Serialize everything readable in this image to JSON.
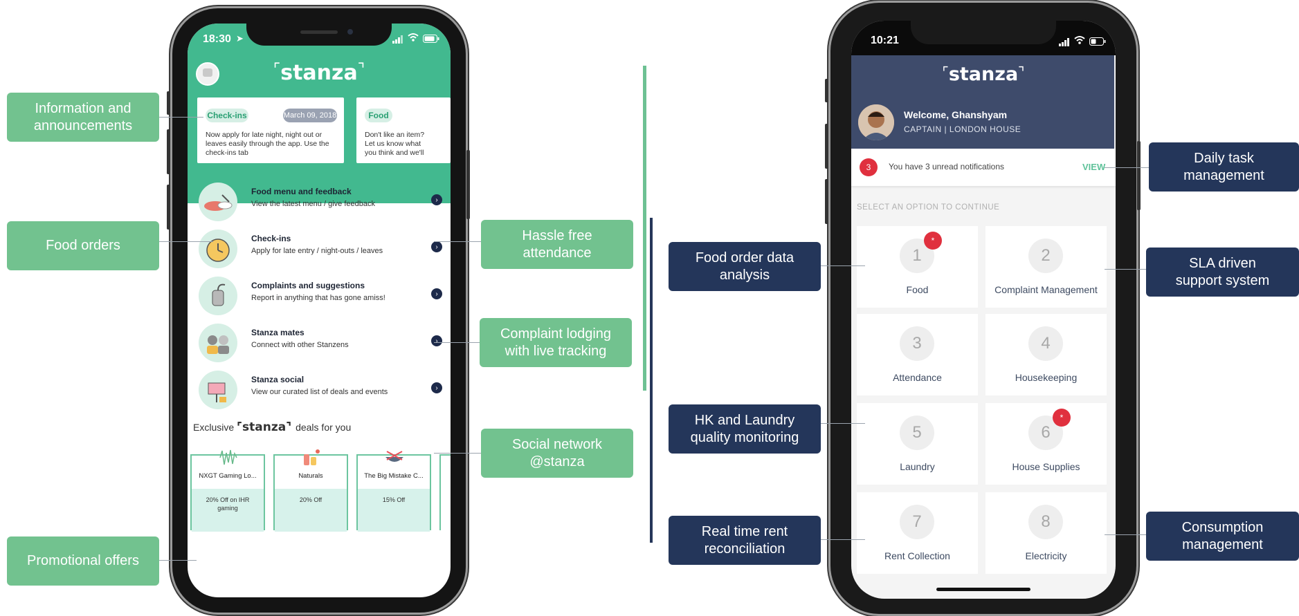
{
  "left_phone": {
    "status_time": "18:30",
    "logo": "stanza",
    "cards": [
      {
        "tag": "Check-ins",
        "date": "March 09, 2018",
        "text": "Now apply for late night, night out or leaves easily through the app. Use the check-ins tab"
      },
      {
        "tag": "Food",
        "text": "Don't like an item? Let us know what you think and we'll continuously improve"
      }
    ],
    "menu": [
      {
        "title": "Food menu and feedback",
        "subtitle": "View the latest menu / give feedback"
      },
      {
        "title": "Check-ins",
        "subtitle": "Apply for late entry / night-outs / leaves"
      },
      {
        "title": "Complaints and suggestions",
        "subtitle": "Report in anything that has gone amiss!"
      },
      {
        "title": "Stanza mates",
        "subtitle": "Connect with other Stanzens"
      },
      {
        "title": "Stanza social",
        "subtitle": "View our curated list of deals and events"
      }
    ],
    "deals_prefix": "Exclusive",
    "deals_logo": "stanza",
    "deals_suffix": "deals for you",
    "deals": [
      {
        "name": "NXGT Gaming Lo...",
        "offer": "20% Off on IHR gaming"
      },
      {
        "name": "Naturals",
        "offer": "20% Off"
      },
      {
        "name": "The Big Mistake C...",
        "offer": "15% Off"
      }
    ]
  },
  "right_phone": {
    "status_time": "10:21",
    "logo": "stanza",
    "welcome": "Welcome, Ghanshyam",
    "role": "CAPTAIN | LONDON HOUSE",
    "notif_count": "3",
    "notif_text": "You have 3 unread notifications",
    "view_label": "VIEW",
    "select_prompt": "SELECT AN OPTION TO CONTINUE",
    "tiles": [
      {
        "num": "1",
        "label": "Food",
        "badge": "*"
      },
      {
        "num": "2",
        "label": "Complaint Management"
      },
      {
        "num": "3",
        "label": "Attendance"
      },
      {
        "num": "4",
        "label": "Housekeeping"
      },
      {
        "num": "5",
        "label": "Laundry"
      },
      {
        "num": "6",
        "label": "House Supplies",
        "badge": "*"
      },
      {
        "num": "7",
        "label": "Rent Collection"
      },
      {
        "num": "8",
        "label": "Electricity"
      }
    ]
  },
  "callouts": {
    "info": "Information and\nannouncements",
    "food_orders": "Food orders",
    "promo": "Promotional offers",
    "attendance": "Hassle free\nattendance",
    "complaint": "Complaint lodging\nwith live tracking",
    "social": "Social network\n@stanza",
    "food_analysis": "Food order data\nanalysis",
    "hk": "HK and Laundry\nquality monitoring",
    "rent": "Real time rent\nreconciliation",
    "daily": "Daily task\nmanagement",
    "sla": "SLA driven\nsupport system",
    "consumption": "Consumption\nmanagement"
  },
  "colors": {
    "green": "#72c28f",
    "navy": "#24365a",
    "teal": "#42b98f",
    "header_navy": "#3e4b6b",
    "badge_red": "#e0303e"
  }
}
